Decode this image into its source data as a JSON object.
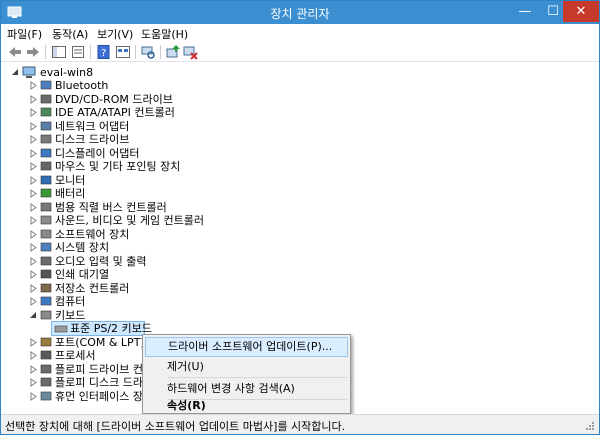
{
  "window": {
    "title": "장치 관리자",
    "min_glyph": "—",
    "max_glyph": "☐",
    "close_glyph": "✕"
  },
  "menu": [
    "파일(F)",
    "동작(A)",
    "보기(V)",
    "도움말(H)"
  ],
  "toolbar_icons": [
    "back-arrow-icon",
    "forward-arrow-icon",
    "show-hide-tree-icon",
    "properties-icon",
    "help-icon",
    "view-icon",
    "scan-hardware-icon",
    "update-driver-icon",
    "uninstall-icon"
  ],
  "tree": {
    "root": "eval-win8",
    "categories": [
      {
        "label": "Bluetooth",
        "icon": "bluetooth-icon"
      },
      {
        "label": "DVD/CD-ROM 드라이브",
        "icon": "dvd-drive-icon"
      },
      {
        "label": "IDE ATA/ATAPI 컨트롤러",
        "icon": "ide-controller-icon"
      },
      {
        "label": "네트워크 어댑터",
        "icon": "network-adapter-icon"
      },
      {
        "label": "디스크 드라이브",
        "icon": "disk-drive-icon"
      },
      {
        "label": "디스플레이 어댑터",
        "icon": "display-adapter-icon"
      },
      {
        "label": "마우스 및 기타 포인팅 장치",
        "icon": "mouse-icon"
      },
      {
        "label": "모니터",
        "icon": "monitor-icon"
      },
      {
        "label": "배터리",
        "icon": "battery-icon"
      },
      {
        "label": "범용 직렬 버스 컨트롤러",
        "icon": "usb-controller-icon"
      },
      {
        "label": "사운드, 비디오 및 게임 컨트롤러",
        "icon": "sound-icon"
      },
      {
        "label": "소프트웨어 장치",
        "icon": "software-device-icon"
      },
      {
        "label": "시스템 장치",
        "icon": "system-device-icon"
      },
      {
        "label": "오디오 입력 및 출력",
        "icon": "audio-io-icon"
      },
      {
        "label": "인쇄 대기열",
        "icon": "printer-icon"
      },
      {
        "label": "저장소 컨트롤러",
        "icon": "storage-controller-icon"
      },
      {
        "label": "컴퓨터",
        "icon": "computer-icon"
      },
      {
        "label": "키보드",
        "icon": "keyboard-icon",
        "expanded": true
      },
      {
        "label": "포트(COM & LPT)",
        "icon": "port-icon"
      },
      {
        "label": "프로세서",
        "icon": "processor-icon"
      },
      {
        "label": "플로피 드라이브 컨트",
        "icon": "floppy-controller-icon"
      },
      {
        "label": "플로피 디스크 드라이",
        "icon": "floppy-drive-icon"
      },
      {
        "label": "휴먼 인터페이스 장치",
        "icon": "hid-icon"
      }
    ],
    "keyboard_child": "표준 PS/2 키보드"
  },
  "context_menu": {
    "update_driver": "드라이버 소프트웨어 업데이트(P)...",
    "uninstall": "제거(U)",
    "scan": "하드웨어 변경 사항 검색(A)",
    "properties": "속성(R)"
  },
  "status": "선택한 장치에 대해 [드라이버 소프트웨어 업데이트 마법사]를 시작합니다.",
  "colors": {
    "titlebar": "#3b8fd1",
    "close": "#c7392b",
    "selection": "#cde8ff",
    "menu_highlight": "#dbeeff"
  }
}
